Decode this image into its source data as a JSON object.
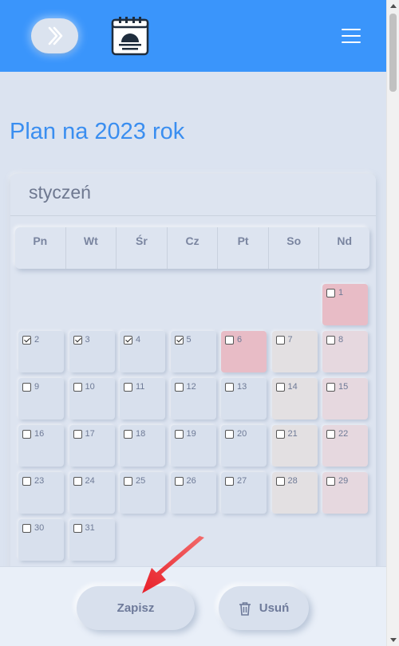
{
  "header": {
    "nav_toggle_icon": "double-chevron-right-icon",
    "logo_icon": "calendar-sunset-icon",
    "menu_icon": "hamburger-icon"
  },
  "page": {
    "title": "Plan na 2023 rok"
  },
  "month": {
    "name": "styczeń",
    "weekdays": [
      "Pn",
      "Wt",
      "Śr",
      "Cz",
      "Pt",
      "So",
      "Nd"
    ],
    "days": [
      {
        "day": "1",
        "checked": false,
        "type": "holiday"
      },
      {
        "day": "2",
        "checked": true,
        "type": "weekday"
      },
      {
        "day": "3",
        "checked": true,
        "type": "weekday"
      },
      {
        "day": "4",
        "checked": true,
        "type": "weekday"
      },
      {
        "day": "5",
        "checked": true,
        "type": "weekday"
      },
      {
        "day": "6",
        "checked": false,
        "type": "holiday"
      },
      {
        "day": "7",
        "checked": false,
        "type": "saturday"
      },
      {
        "day": "8",
        "checked": false,
        "type": "sunday"
      },
      {
        "day": "9",
        "checked": false,
        "type": "weekday"
      },
      {
        "day": "10",
        "checked": false,
        "type": "weekday"
      },
      {
        "day": "11",
        "checked": false,
        "type": "weekday"
      },
      {
        "day": "12",
        "checked": false,
        "type": "weekday"
      },
      {
        "day": "13",
        "checked": false,
        "type": "weekday"
      },
      {
        "day": "14",
        "checked": false,
        "type": "saturday"
      },
      {
        "day": "15",
        "checked": false,
        "type": "sunday"
      },
      {
        "day": "16",
        "checked": false,
        "type": "weekday"
      },
      {
        "day": "17",
        "checked": false,
        "type": "weekday"
      },
      {
        "day": "18",
        "checked": false,
        "type": "weekday"
      },
      {
        "day": "19",
        "checked": false,
        "type": "weekday"
      },
      {
        "day": "20",
        "checked": false,
        "type": "weekday"
      },
      {
        "day": "21",
        "checked": false,
        "type": "saturday"
      },
      {
        "day": "22",
        "checked": false,
        "type": "sunday"
      },
      {
        "day": "23",
        "checked": false,
        "type": "weekday"
      },
      {
        "day": "24",
        "checked": false,
        "type": "weekday"
      },
      {
        "day": "25",
        "checked": false,
        "type": "weekday"
      },
      {
        "day": "26",
        "checked": false,
        "type": "weekday"
      },
      {
        "day": "27",
        "checked": false,
        "type": "weekday"
      },
      {
        "day": "28",
        "checked": false,
        "type": "saturday"
      },
      {
        "day": "29",
        "checked": false,
        "type": "sunday"
      },
      {
        "day": "30",
        "checked": false,
        "type": "weekday"
      },
      {
        "day": "31",
        "checked": false,
        "type": "weekday"
      }
    ]
  },
  "footer": {
    "save_label": "Zapisz",
    "delete_label": "Usuń",
    "delete_icon": "trash-icon"
  },
  "colors": {
    "accent": "#3a95fb",
    "background": "#dbe3f0",
    "holiday": "#e8bcc6",
    "saturday": "#e3e0e2",
    "sunday": "#e6d8df",
    "annotation_arrow": "#e8202a"
  }
}
